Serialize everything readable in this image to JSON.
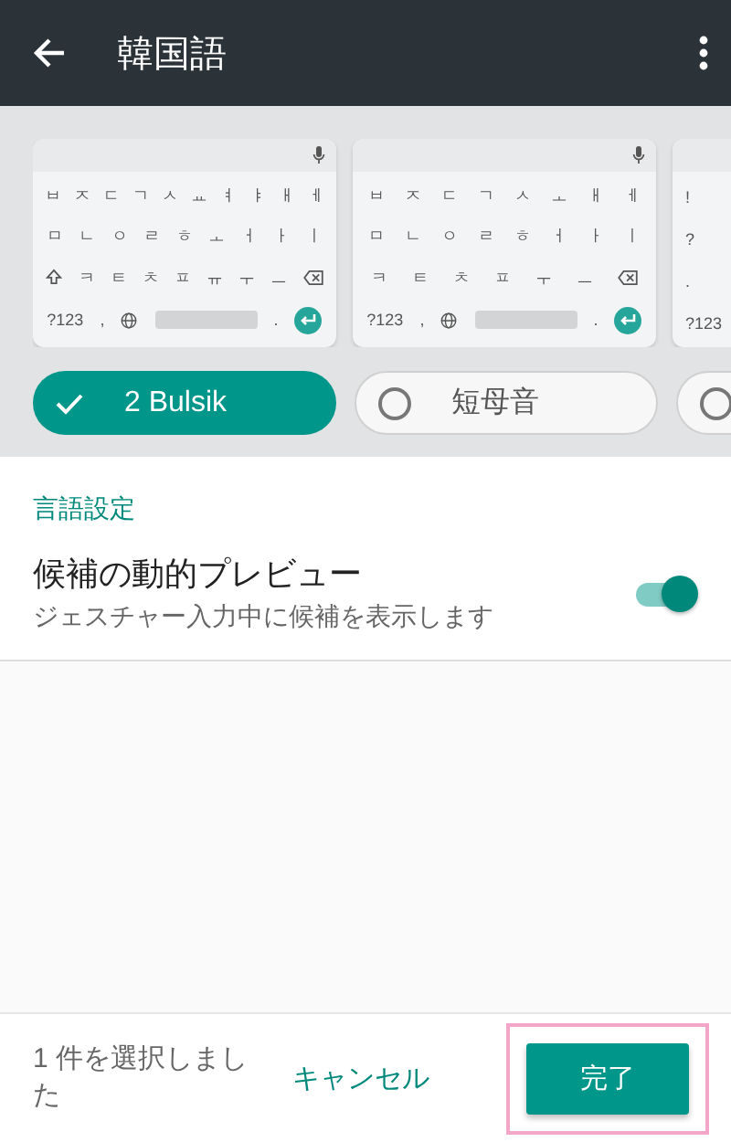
{
  "app_bar": {
    "title": "韓国語"
  },
  "keyboards": [
    {
      "key_rows": [
        {
          "keys": [
            {
              "kind": "key",
              "label": "ㅂ"
            },
            {
              "kind": "key",
              "label": "ㅈ"
            },
            {
              "kind": "key",
              "label": "ㄷ"
            },
            {
              "kind": "key",
              "label": "ㄱ"
            },
            {
              "kind": "key",
              "label": "ㅅ"
            },
            {
              "kind": "key",
              "label": "ㅛ"
            },
            {
              "kind": "key",
              "label": "ㅕ"
            },
            {
              "kind": "key",
              "label": "ㅑ"
            },
            {
              "kind": "key",
              "label": "ㅐ"
            },
            {
              "kind": "key",
              "label": "ㅔ"
            }
          ]
        },
        {
          "keys": [
            {
              "kind": "key",
              "label": "ㅁ"
            },
            {
              "kind": "key",
              "label": "ㄴ"
            },
            {
              "kind": "key",
              "label": "ㅇ"
            },
            {
              "kind": "key",
              "label": "ㄹ"
            },
            {
              "kind": "key",
              "label": "ㅎ"
            },
            {
              "kind": "key",
              "label": "ㅗ"
            },
            {
              "kind": "key",
              "label": "ㅓ"
            },
            {
              "kind": "key",
              "label": "ㅏ"
            },
            {
              "kind": "key",
              "label": "ㅣ"
            }
          ]
        },
        {
          "keys": [
            {
              "kind": "shift"
            },
            {
              "kind": "key",
              "label": "ㅋ"
            },
            {
              "kind": "key",
              "label": "ㅌ"
            },
            {
              "kind": "key",
              "label": "ㅊ"
            },
            {
              "kind": "key",
              "label": "ㅍ"
            },
            {
              "kind": "key",
              "label": "ㅠ"
            },
            {
              "kind": "key",
              "label": "ㅜ"
            },
            {
              "kind": "key",
              "label": "ㅡ"
            },
            {
              "kind": "backspace"
            }
          ]
        },
        {
          "keys": [
            {
              "kind": "key",
              "label": "?123"
            },
            {
              "kind": "key",
              "label": ","
            },
            {
              "kind": "globe"
            },
            {
              "kind": "space"
            },
            {
              "kind": "key",
              "label": "."
            },
            {
              "kind": "enter"
            }
          ]
        }
      ]
    },
    {
      "key_rows": [
        {
          "keys": [
            {
              "kind": "key",
              "label": "ㅂ"
            },
            {
              "kind": "key",
              "label": "ㅈ"
            },
            {
              "kind": "key",
              "label": "ㄷ"
            },
            {
              "kind": "key",
              "label": "ㄱ"
            },
            {
              "kind": "key",
              "label": "ㅅ"
            },
            {
              "kind": "key",
              "label": "ㅗ"
            },
            {
              "kind": "key",
              "label": "ㅐ"
            },
            {
              "kind": "key",
              "label": "ㅔ"
            }
          ]
        },
        {
          "keys": [
            {
              "kind": "key",
              "label": "ㅁ"
            },
            {
              "kind": "key",
              "label": "ㄴ"
            },
            {
              "kind": "key",
              "label": "ㅇ"
            },
            {
              "kind": "key",
              "label": "ㄹ"
            },
            {
              "kind": "key",
              "label": "ㅎ"
            },
            {
              "kind": "key",
              "label": "ㅓ"
            },
            {
              "kind": "key",
              "label": "ㅏ"
            },
            {
              "kind": "key",
              "label": "ㅣ"
            }
          ]
        },
        {
          "keys": [
            {
              "kind": "key",
              "label": "ㅋ"
            },
            {
              "kind": "key",
              "label": "ㅌ"
            },
            {
              "kind": "key",
              "label": "ㅊ"
            },
            {
              "kind": "key",
              "label": "ㅍ"
            },
            {
              "kind": "key",
              "label": "ㅜ"
            },
            {
              "kind": "key",
              "label": "ㅡ"
            },
            {
              "kind": "backspace"
            }
          ]
        },
        {
          "keys": [
            {
              "kind": "key",
              "label": "?123"
            },
            {
              "kind": "key",
              "label": ","
            },
            {
              "kind": "globe"
            },
            {
              "kind": "space"
            },
            {
              "kind": "key",
              "label": "."
            },
            {
              "kind": "enter"
            }
          ]
        }
      ]
    },
    {
      "key_rows": [
        {
          "keys": [
            {
              "kind": "key",
              "label": "!"
            }
          ]
        },
        {
          "keys": [
            {
              "kind": "key",
              "label": "?"
            }
          ]
        },
        {
          "keys": [
            {
              "kind": "key",
              "label": "."
            }
          ]
        },
        {
          "keys": [
            {
              "kind": "key",
              "label": "?123"
            }
          ]
        }
      ]
    }
  ],
  "layout_chips": [
    {
      "label": "2 Bulsik",
      "selected": true
    },
    {
      "label": "短母音",
      "selected": false
    },
    {
      "selected": false
    }
  ],
  "section_header": "言語設定",
  "settings": [
    {
      "title": "候補の動的プレビュー",
      "subtitle": "ジェスチャー入力中に候補を表示します",
      "on": true
    }
  ],
  "footer": {
    "status": "1 件を選択しました",
    "cancel": "キャンセル",
    "done": "完了",
    "done_highlighted": true
  }
}
